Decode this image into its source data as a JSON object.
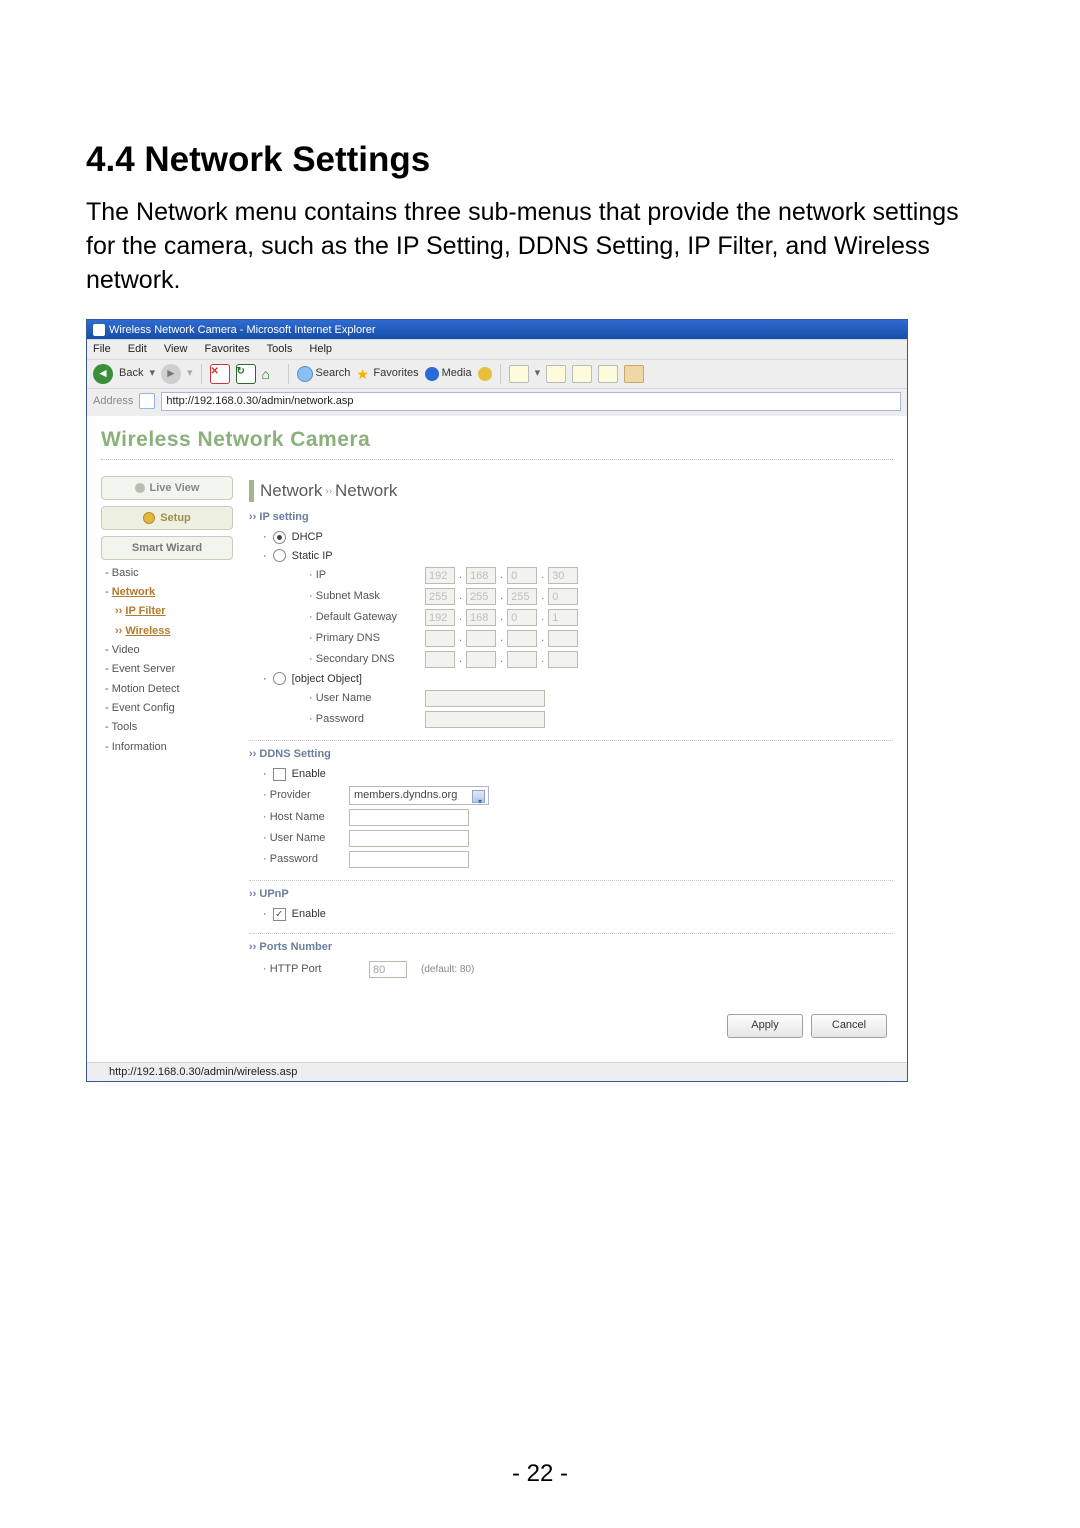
{
  "doc": {
    "heading": "4.4  Network Settings",
    "paragraph": "The Network menu contains three sub-menus that provide the network settings for the camera, such as the IP Setting, DDNS Setting, IP Filter, and Wireless network.",
    "page_number": "- 22 -"
  },
  "browser": {
    "title": "Wireless Network Camera - Microsoft Internet Explorer",
    "menus": {
      "file": "File",
      "edit": "Edit",
      "view": "View",
      "favorites": "Favorites",
      "tools": "Tools",
      "help": "Help"
    },
    "toolbar": {
      "back": "Back",
      "search": "Search",
      "fav": "Favorites",
      "media": "Media"
    },
    "address_label": "Address",
    "url": "http://192.168.0.30/admin/network.asp",
    "status_url": "http://192.168.0.30/admin/wireless.asp"
  },
  "camera": {
    "brand": "Wireless Network Camera",
    "tabs": {
      "live": "Live View",
      "setup": "Setup",
      "wizard": "Smart Wizard"
    },
    "nav": {
      "basic": "Basic",
      "network": "Network",
      "ipfilter": "IP Filter",
      "wireless": "Wireless",
      "video": "Video",
      "eventserver": "Event Server",
      "motion": "Motion Detect",
      "eventconfig": "Event Config",
      "tools": "Tools",
      "info": "Information"
    },
    "breadcrumb": {
      "a": "Network",
      "b": "Network"
    }
  },
  "ip": {
    "section": "IP setting",
    "dhcp": "DHCP",
    "static": "Static IP",
    "pppoe": {
      "user": "",
      "pass": ""
    },
    "labels": {
      "ip": "IP",
      "subnet": "Subnet Mask",
      "gateway": "Default Gateway",
      "pdns": "Primary DNS",
      "sdns": "Secondary DNS",
      "user": "User Name",
      "pass": "Password"
    },
    "addr": {
      "ip": [
        "192",
        "168",
        "0",
        "30"
      ],
      "subnet": [
        "255",
        "255",
        "255",
        "0"
      ],
      "gateway": [
        "192",
        "168",
        "0",
        "1"
      ],
      "pdns": [
        "",
        "",
        "",
        ""
      ],
      "sdns": [
        "",
        "",
        "",
        ""
      ]
    }
  },
  "ddns": {
    "section": "DDNS Setting",
    "enable": "Enable",
    "labels": {
      "provider": "Provider",
      "host": "Host Name",
      "user": "User Name",
      "pass": "Password"
    },
    "provider_value": "members.dyndns.org",
    "host": "",
    "user": "",
    "pass": ""
  },
  "upnp": {
    "section": "UPnP",
    "enable": "Enable"
  },
  "ports": {
    "section": "Ports Number",
    "http_label": "HTTP Port",
    "http_value": "80",
    "hint": "(default: 80)"
  },
  "buttons": {
    "apply": "Apply",
    "cancel": "Cancel"
  }
}
